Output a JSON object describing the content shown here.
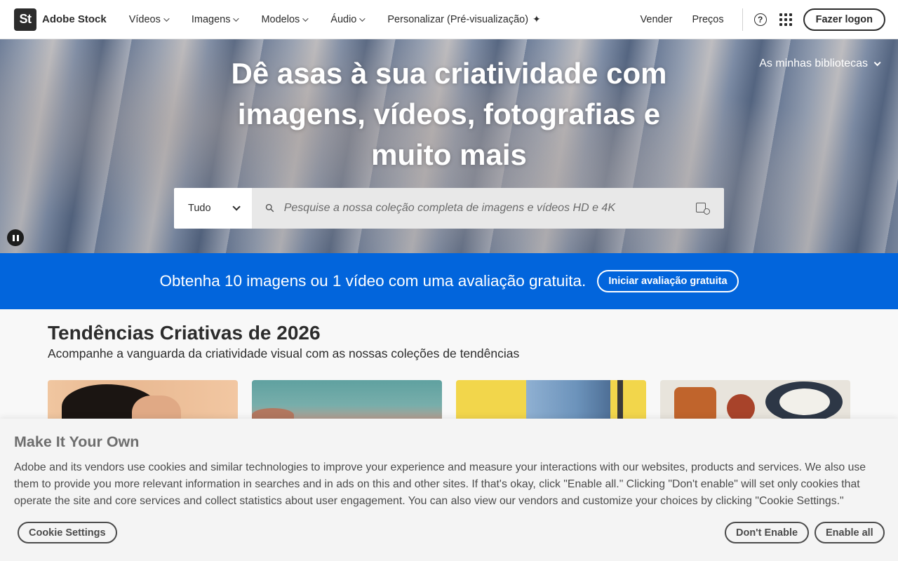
{
  "header": {
    "logo_mark": "St",
    "logo_text": "Adobe Stock",
    "nav": [
      {
        "label": "Vídeos"
      },
      {
        "label": "Imagens"
      },
      {
        "label": "Modelos"
      },
      {
        "label": "Áudio"
      },
      {
        "label": "Personalizar (Pré-visualização)"
      }
    ],
    "sell_label": "Vender",
    "pricing_label": "Preços",
    "help_icon": "help-icon",
    "apps_icon": "apps-grid-icon",
    "signin_label": "Fazer logon"
  },
  "hero": {
    "title": "Dê asas à sua criatividade com imagens, vídeos, fotografias e muito mais",
    "libraries_label": "As minhas bibliotecas",
    "search_type": "Tudo",
    "search_placeholder": "Pesquise a nossa coleção completa de imagens e vídeos HD e 4K"
  },
  "promo": {
    "text": "Obtenha 10 imagens ou 1 vídeo com uma avaliação gratuita.",
    "button_label": "Iniciar avaliação gratuita",
    "color": "#0265dc"
  },
  "trends": {
    "title": "Tendências Criativas de 2026",
    "subtitle": "Acompanhe a vanguarda da criatividade visual com as nossas coleções de tendências"
  },
  "cookie": {
    "title": "Make It Your Own",
    "body": "Adobe and its vendors use cookies and similar technologies to improve your experience and measure your interactions with our websites, products and services. We also use them to provide you more relevant information in searches and in ads on this and other sites. If that's okay, click \"Enable all.\" Clicking \"Don't enable\" will set only cookies that operate the site and core services and collect statistics about user engagement. You can also view our vendors and customize your choices by clicking \"Cookie Settings.\"",
    "settings_label": "Cookie Settings",
    "disable_label": "Don't Enable",
    "enable_label": "Enable all"
  }
}
